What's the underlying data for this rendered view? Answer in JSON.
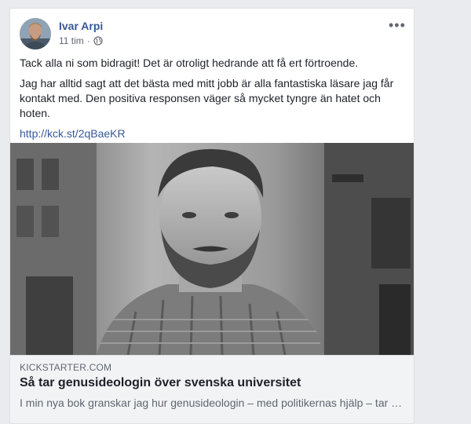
{
  "post": {
    "author": "Ivar Arpi",
    "timestamp": "11 tim",
    "separator": "·",
    "privacy_icon": "globe-icon",
    "more_label": "•••",
    "paragraphs": [
      "Tack alla ni som bidragit! Det är otroligt hedrande att få ert förtroende.",
      "Jag har alltid sagt att det bästa med mitt jobb är alla fantastiska läsare jag får kontakt med. Den positiva responsen väger så mycket tyngre än hatet och hoten."
    ],
    "link": "http://kck.st/2qBaeKR"
  },
  "link_preview": {
    "domain": "KICKSTARTER.COM",
    "title": "Så tar genusideologin över svenska universitet",
    "description": "I min nya bok granskar jag hur genusideologin – med politikernas hjälp – tar över svenska universitet"
  },
  "colors": {
    "link": "#385898",
    "background": "#e9ebee",
    "caption_bg": "#f2f3f5"
  }
}
